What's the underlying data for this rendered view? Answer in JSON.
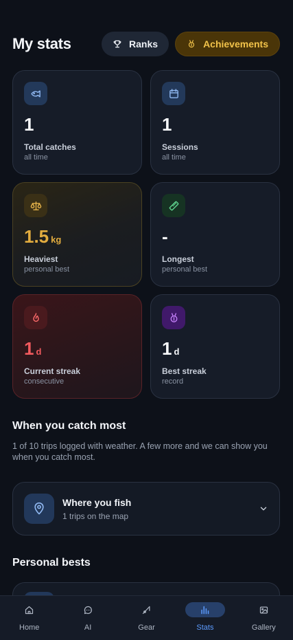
{
  "header": {
    "title": "My stats",
    "ranks_label": "Ranks",
    "achievements_label": "Achievements"
  },
  "cards": [
    {
      "value": "1",
      "unit": "",
      "label": "Total catches",
      "sub": "all time",
      "icon": "fish-icon"
    },
    {
      "value": "1",
      "unit": "",
      "label": "Sessions",
      "sub": "all time",
      "icon": "calendar-icon"
    },
    {
      "value": "1.5",
      "unit": "kg",
      "label": "Heaviest",
      "sub": "personal best",
      "icon": "scale-icon"
    },
    {
      "value": "-",
      "unit": "",
      "label": "Longest",
      "sub": "personal best",
      "icon": "ruler-icon"
    },
    {
      "value": "1",
      "unit": "d",
      "label": "Current streak",
      "sub": "consecutive",
      "icon": "flame-icon"
    },
    {
      "value": "1",
      "unit": "d",
      "label": "Best streak",
      "sub": "record",
      "icon": "medal-icon"
    }
  ],
  "weather_section": {
    "title": "When you catch most",
    "description": "1 of 10 trips logged with weather. A few more and we can show you when you catch most."
  },
  "where_you_fish": {
    "title": "Where you fish",
    "subtitle": "1 trips on the map",
    "icon": "map-pin-icon"
  },
  "personal_bests": {
    "title": "Personal bests"
  },
  "nav": {
    "items": [
      {
        "label": "Home",
        "icon": "home-icon"
      },
      {
        "label": "AI",
        "icon": "chat-icon"
      },
      {
        "label": "Gear",
        "icon": "rod-icon"
      },
      {
        "label": "Stats",
        "icon": "bar-chart-icon",
        "active": true
      },
      {
        "label": "Gallery",
        "icon": "image-icon"
      }
    ]
  },
  "colors": {
    "background": "#0d1119",
    "accent_blue": "#5c9bff",
    "gold": "#e2ac3f",
    "red": "#f15a5e"
  }
}
